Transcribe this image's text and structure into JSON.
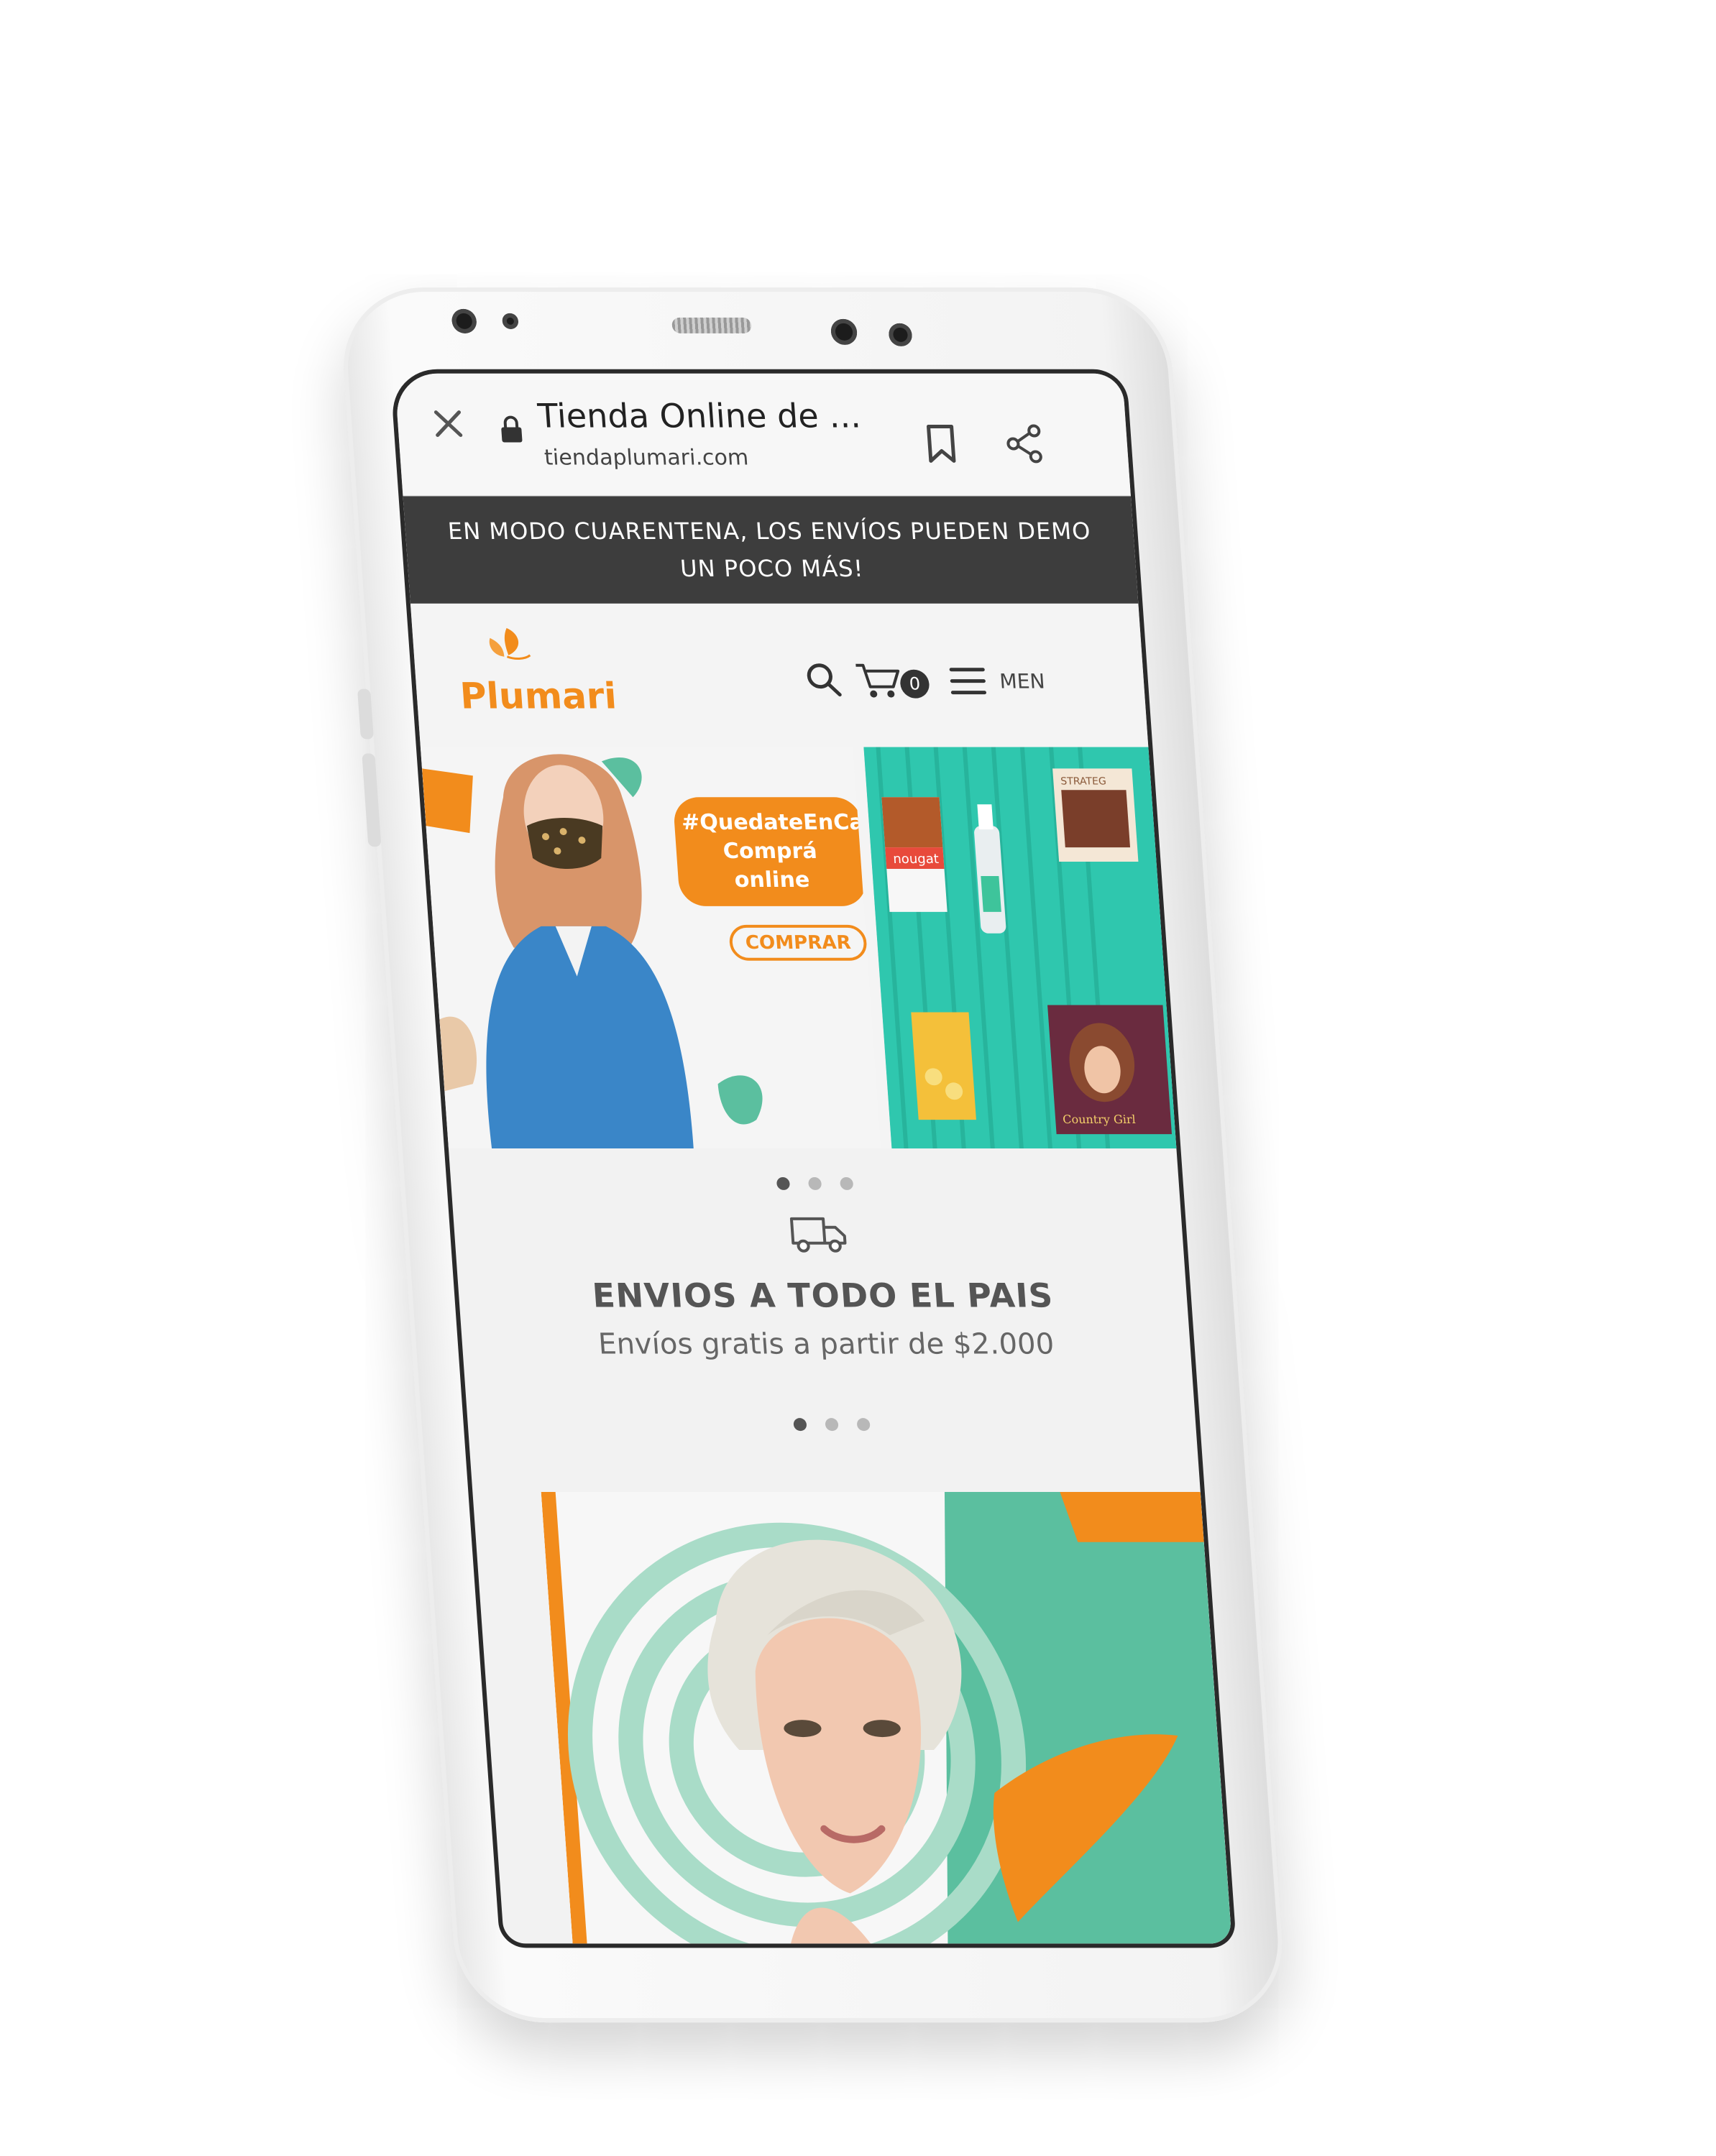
{
  "browser": {
    "title": "Tienda Online de ...",
    "url": "tiendaplumari.com"
  },
  "announcement": {
    "line1": "EN MODO CUARENTENA, LOS ENVÍOS PUEDEN DEMO",
    "line2": "UN POCO MÁS!"
  },
  "header": {
    "logo": "Plumari",
    "cart_count": "0",
    "menu_label": "MEN"
  },
  "hero": {
    "hashtag_line1": "#QuedateEnCasa",
    "hashtag_line2": "Comprá online",
    "cta": "COMPRAR",
    "products": [
      "nougat",
      "STRATEG",
      "Country Girl"
    ]
  },
  "shipping": {
    "title": "ENVIOS A TODO EL PAIS",
    "subtitle": "Envíos gratis a partir de $2.000"
  },
  "carousel_dots": {
    "count": 3,
    "active_index": 0
  },
  "colors": {
    "brand_orange": "#f28c1c",
    "teal": "#2fc7ae",
    "mint": "#5bbf9f",
    "announcement_bg": "#3d3d3d"
  }
}
